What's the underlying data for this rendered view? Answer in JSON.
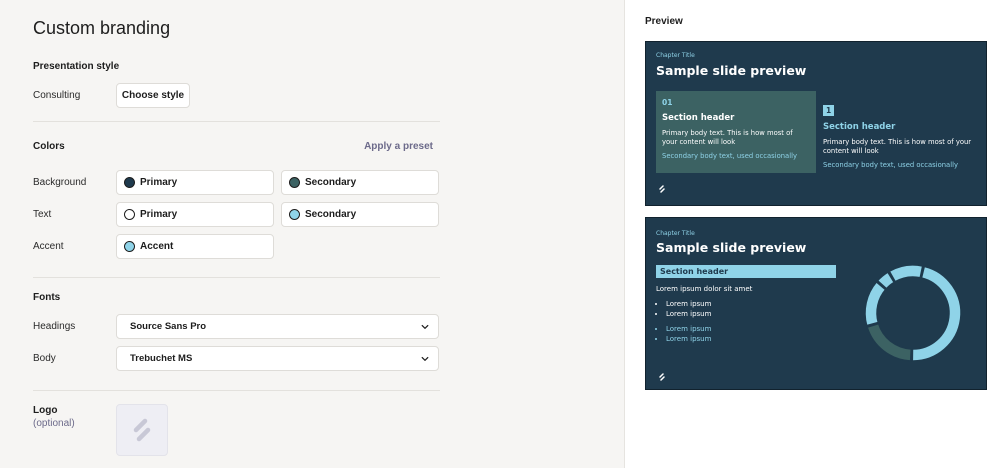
{
  "page_title": "Custom branding",
  "presentation_style": {
    "section_title": "Presentation style",
    "label": "Consulting",
    "button": "Choose style"
  },
  "colors": {
    "section_title": "Colors",
    "preset_link": "Apply a preset",
    "rows": {
      "background": {
        "label": "Background",
        "primary": "Primary",
        "secondary": "Secondary",
        "primary_color": "#1f3a4d",
        "secondary_color": "#3c6263"
      },
      "text": {
        "label": "Text",
        "primary": "Primary",
        "secondary": "Secondary",
        "primary_color": "#ffffff",
        "secondary_color": "#8fd3e8"
      },
      "accent": {
        "label": "Accent",
        "primary": "Accent",
        "primary_color": "#8fd3e8"
      }
    }
  },
  "fonts": {
    "section_title": "Fonts",
    "headings_label": "Headings",
    "headings_value": "Source Sans Pro",
    "body_label": "Body",
    "body_value": "Trebuchet MS"
  },
  "logo": {
    "label": "Logo",
    "optional": "(optional)"
  },
  "preview": {
    "label": "Preview",
    "slide1": {
      "chapter": "Chapter Title",
      "title": "Sample slide preview",
      "card_a": {
        "num": "01",
        "header": "Section header",
        "body": "Primary body text. This is how most of your content will look",
        "secondary": "Secondary body text, used occasionally"
      },
      "card_b": {
        "num": "1",
        "header": "Section header",
        "body": "Primary body text. This is how most of your content will look",
        "secondary": "Secondary body text, used occasionally"
      }
    },
    "slide2": {
      "chapter": "Chapter Title",
      "title": "Sample slide preview",
      "section_header": "Section header",
      "lorem": "Lorem ipsum dolor sit amet",
      "bullets_primary": [
        "Lorem ipsum",
        "Lorem ipsum"
      ],
      "bullets_secondary": [
        "Lorem ipsum",
        "Lorem ipsum"
      ],
      "donut_segments": [
        {
          "value": 47,
          "color": "#8fd3e8"
        },
        {
          "value": 20,
          "color": "#3c6263"
        },
        {
          "value": 16,
          "color": "#8fd3e8"
        },
        {
          "value": 5,
          "color": "#8fd3e8"
        },
        {
          "value": 12,
          "color": "#8fd3e8"
        }
      ]
    }
  },
  "colors_palette": {
    "navy": "#1f3a4d",
    "teal": "#3c6263",
    "cyan": "#8fd3e8",
    "link": "#6c6a8a"
  }
}
